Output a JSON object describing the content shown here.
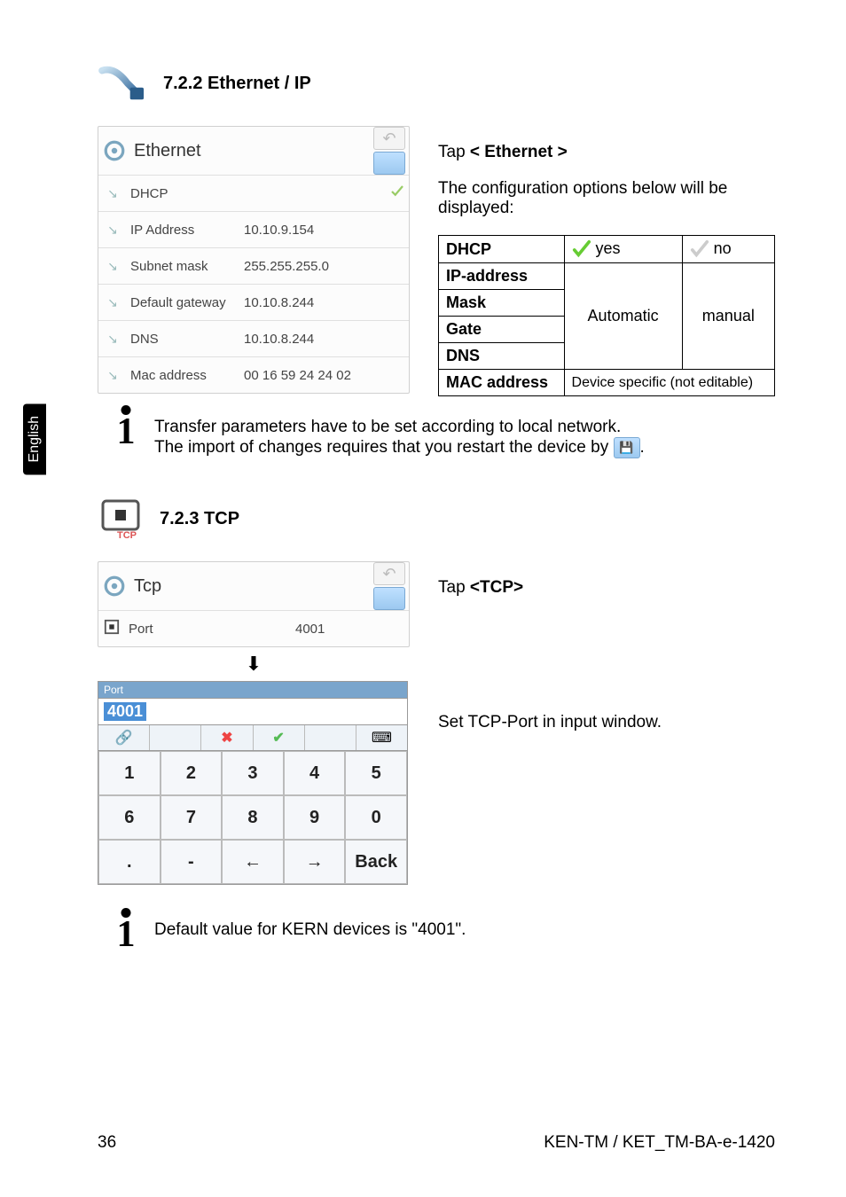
{
  "lang_tab": "English",
  "sections": {
    "ethernet_heading": "7.2.2  Ethernet / IP",
    "tcp_heading": "7.2.3  TCP"
  },
  "ethernet_panel": {
    "title": "Ethernet",
    "rows": [
      {
        "label": "DHCP",
        "value": ""
      },
      {
        "label": "IP Address",
        "value": "10.10.9.154"
      },
      {
        "label": "Subnet mask",
        "value": "255.255.255.0"
      },
      {
        "label": "Default gateway",
        "value": "10.10.8.244"
      },
      {
        "label": "DNS",
        "value": "10.10.8.244"
      },
      {
        "label": "Mac address",
        "value": "00 16 59 24 24 02"
      }
    ]
  },
  "ethernet_text": {
    "tap": "Tap ",
    "tap_bold": "< Ethernet >",
    "desc": "The configuration options below will be displayed:"
  },
  "opt_table": {
    "rows": [
      "DHCP",
      "IP-address",
      "Mask",
      "Gate",
      "DNS",
      "MAC address"
    ],
    "yes": "yes",
    "no": "no",
    "auto": "Automatic",
    "manual": "manual",
    "mac": "Device specific (not editable)"
  },
  "info1_line1": "Transfer parameters have to be set according to local network.",
  "info1_line2a": "The import of changes requires that you restart the device by ",
  "info1_line2b": ".",
  "tcp_panel": {
    "title": "Tcp",
    "port_label": "Port",
    "port_value": "4001"
  },
  "tcp_text": {
    "tap": "Tap ",
    "tap_bold": "<TCP>",
    "desc": "Set TCP-Port in input window."
  },
  "keypad": {
    "title": "Port",
    "value": "4001",
    "keys": [
      [
        "1",
        "2",
        "3",
        "4",
        "5"
      ],
      [
        "6",
        "7",
        "8",
        "9",
        "0"
      ],
      [
        ".",
        "-",
        "←",
        "→",
        "Back"
      ]
    ],
    "tool_x": "✖",
    "tool_ok": "✔"
  },
  "info2": "Default value for KERN devices is \"4001\".",
  "footer": {
    "page": "36",
    "doc": "KEN-TM / KET_TM-BA-e-1420"
  }
}
